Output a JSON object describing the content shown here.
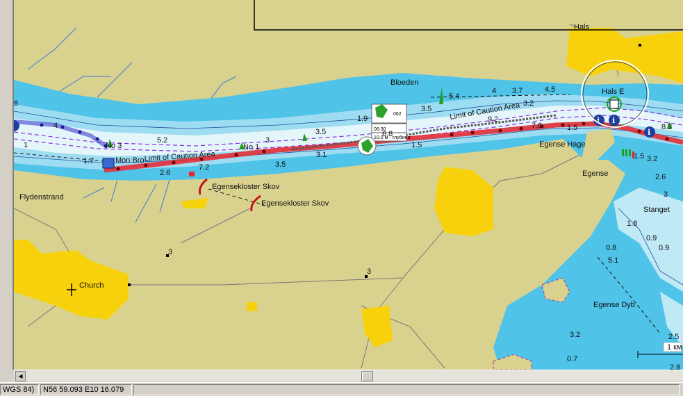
{
  "map": {
    "place_labels": {
      "hals": "Hals",
      "hals_e": "Hals E",
      "mon_bro": "Mon Bro",
      "limit_caution_1": "Limit of Caution Area",
      "limit_caution_2": "Limit of Caution Area",
      "egense_hage": "Egense Hage",
      "egense": "Egense",
      "stanget": "Stanget",
      "egense_dyb": "Egense Dyb",
      "egensekloster_1": "Egensekloster Skov",
      "egensekloster_2": "Egensekloster Skov",
      "bloeden": "Bloeden",
      "flydenstrand": "Flydenstrand",
      "church": "Church",
      "no1": "No 1",
      "no3": "No 3"
    },
    "depths": [
      "6",
      "4",
      "1",
      "1.7",
      "5.2",
      "3",
      "2.6",
      "7.2",
      "3.5",
      "3.5",
      "3.1",
      "1.9",
      "3.5",
      "4",
      "5.4",
      "3.7",
      "4.5",
      "3.2",
      "9.2",
      "1.5",
      "6.8",
      "7.6",
      "1.5",
      "8.3",
      "1.5",
      "3.2",
      "2.6",
      "3",
      "1.8",
      "0.9",
      "0.8",
      "0.9",
      "5.1",
      "0.7",
      "3.2",
      "2.5",
      "3",
      "3",
      "2.8"
    ],
    "tide_box": {
      "station": "062",
      "time": "06:30",
      "depth": "10.0 м - глубина"
    },
    "scale_label": "1 км",
    "colors": {
      "land": "#d9d28e",
      "deep_water": "#4fc3e8",
      "shallow_water": "#bfe9f5",
      "built_up": "#f7d20c",
      "route": "#e8242c"
    }
  },
  "statusbar": {
    "datum": "WGS 84)",
    "position": "N56 59.093 E10 16.079"
  }
}
